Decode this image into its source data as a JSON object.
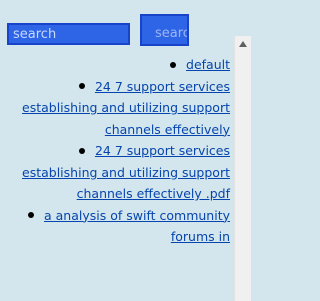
{
  "search": {
    "placeholder": "search",
    "button_label": "search"
  },
  "results": [
    {
      "label": "default"
    },
    {
      "label": "24 7 support services establishing and utilizing support channels effectively"
    },
    {
      "label": "24 7 support services establishing and utilizing support channels effectively .pdf"
    },
    {
      "label": "a analysis of swift community forums in"
    }
  ],
  "icons": {
    "scroll_up": "triangle-up-icon"
  }
}
